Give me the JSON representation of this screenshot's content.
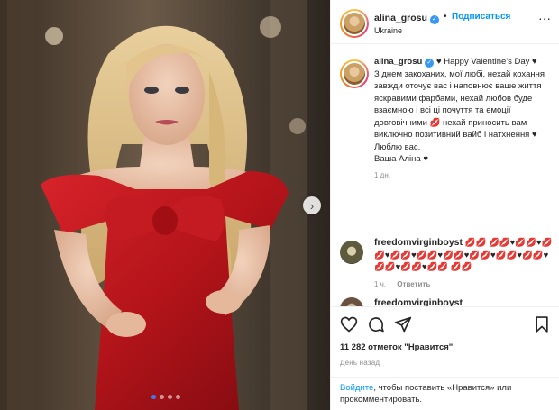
{
  "post": {
    "username": "alina_grosu",
    "location": "Ukraine",
    "follow_label": "Подписаться",
    "separator": "•",
    "more_glyph": "···",
    "next_glyph": "›",
    "carousel": {
      "count": 4,
      "active": 1
    }
  },
  "caption": {
    "username": "alina_grosu",
    "line1": " ♥ Happy Valentine's Day ♥",
    "text": "З днем закоханих, мої любі, нехай кохання завжди оточує вас і наповнює ваше життя яскравими фарбами, нехай любов буде взаємною і всі ці почуття та емоції довговічними 💋 нехай приносить вам виключно позитивний вайб і натхнення ♥\nЛюблю вас.\nВаша Аліна ♥",
    "time": "1 дн."
  },
  "comments": [
    {
      "username": "freedomvirginboyst",
      "text": " 💋💋 💋💋♥💋💋♥💋💋♥💋💋♥💋💋♥💋💋♥💋💋♥💋💋♥💋💋♥💋💋♥💋💋♥💋💋 💋💋",
      "time": "1 ч.",
      "reply_label": "Ответить"
    },
    {
      "username": "freedomvirginboyst",
      "text": "..."
    }
  ],
  "actions": {
    "likes_count": "11 282 отметок",
    "likes_suffix": " \"Нравится\"",
    "date": "День назад"
  },
  "login_prompt": {
    "link": "Войдите",
    "rest": ", чтобы поставить «Нравится» или прокомментировать."
  },
  "colors": {
    "accent": "#0095f6",
    "dress": "#c4161c",
    "verified": "#3897f0"
  },
  "icons": [
    "verified-icon",
    "heart-icon",
    "comment-icon",
    "share-icon",
    "bookmark-icon",
    "chevron-right-icon",
    "more-icon"
  ]
}
